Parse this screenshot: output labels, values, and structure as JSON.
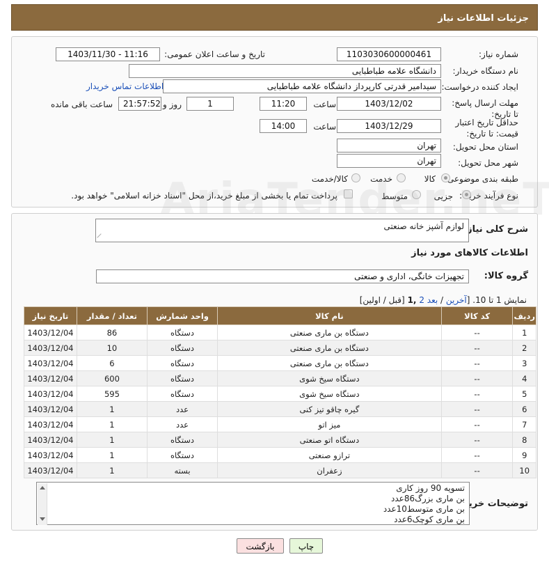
{
  "header": {
    "title": "جزئیات اطلاعات نیاز"
  },
  "fields": {
    "need_number_label": "شماره نیاز:",
    "need_number": "1103030600000461",
    "announce_label": "تاریخ و ساعت اعلان عمومی:",
    "announce_value": "1403/11/30 - 11:16",
    "buyer_org_label": "نام دستگاه خریدار:",
    "buyer_org": "دانشگاه علامه طباطبایی",
    "creator_label": "ایجاد کننده درخواست:",
    "creator": "سیدامیر قدرتی کارپرداز دانشگاه علامه طباطبایی",
    "buyer_contact_link": "اطلاعات تماس خریدار",
    "reply_deadline_label": "مهلت ارسال پاسخ: تا تاریخ:",
    "reply_date": "1403/12/02",
    "time_label": "ساعت",
    "reply_time": "11:20",
    "days_value": "1",
    "days_label": "روز و",
    "remaining_time": "21:57:52",
    "remaining_label": "ساعت باقی مانده",
    "validity_label": "حداقل تاریخ اعتبار قیمت: تا تاریخ:",
    "validity_date": "1403/12/29",
    "validity_time": "14:00",
    "province_label": "استان محل تحویل:",
    "province": "تهران",
    "city_label": "شهر محل تحویل:",
    "city": "تهران",
    "category_label": "طبقه بندی موضوعی:",
    "category_options": [
      "کالا",
      "خدمت",
      "کالا/خدمت"
    ],
    "process_label": "نوع فرآیند خرید :",
    "process_options": [
      "جزیی",
      "متوسط"
    ],
    "payment_note": "پرداخت تمام یا بخشی از مبلغ خرید،از محل \"اسناد خزانه اسلامی\" خواهد بود."
  },
  "details": {
    "description_label": "شرح کلی نیاز:",
    "description": "لوازم آشپز خانه صنعتی",
    "goods_info_title": "اطلاعات کالاهای مورد نیاز",
    "goods_group_label": "گروه کالا:",
    "goods_group": "تجهیزات خانگی، اداری و صنعتی",
    "pagination_prefix": "نمایش 1 تا 10. [",
    "pagination_last": "آخرین",
    "pagination_sep": " / ",
    "pagination_next": "بعد",
    "pagination_page2": "2",
    "pagination_page1": "1",
    "pagination_suffix": "[قبل / اولین]",
    "table": {
      "headers": [
        "ردیف",
        "کد کالا",
        "نام کالا",
        "واحد شمارش",
        "تعداد / مقدار",
        "تاریخ نیاز"
      ],
      "rows": [
        [
          "1",
          "--",
          "دستگاه بن ماری صنعتی",
          "دستگاه",
          "86",
          "1403/12/04"
        ],
        [
          "2",
          "--",
          "دستگاه بن ماری صنعتی",
          "دستگاه",
          "10",
          "1403/12/04"
        ],
        [
          "3",
          "--",
          "دستگاه بن ماری صنعتی",
          "دستگاه",
          "6",
          "1403/12/04"
        ],
        [
          "4",
          "--",
          "دستگاه سیخ شوی",
          "دستگاه",
          "600",
          "1403/12/04"
        ],
        [
          "5",
          "--",
          "دستگاه سیخ شوی",
          "دستگاه",
          "595",
          "1403/12/04"
        ],
        [
          "6",
          "--",
          "گیره چاقو تیز کنی",
          "عدد",
          "1",
          "1403/12/04"
        ],
        [
          "7",
          "--",
          "میز اتو",
          "عدد",
          "1",
          "1403/12/04"
        ],
        [
          "8",
          "--",
          "دستگاه اتو صنعتی",
          "دستگاه",
          "1",
          "1403/12/04"
        ],
        [
          "9",
          "--",
          "ترازو صنعتی",
          "دستگاه",
          "1",
          "1403/12/04"
        ],
        [
          "10",
          "--",
          "زعفران",
          "بسته",
          "1",
          "1403/12/04"
        ]
      ]
    },
    "buyer_notes_label": "توضیحات خریدار:",
    "buyer_notes": [
      "تسویه 90 روز کاری",
      "بن ماری بزرگ86عدد",
      "بن ماری متوسط10عدد",
      "بن ماری کوچک6عدد"
    ]
  },
  "buttons": {
    "print": "چاپ",
    "back": "بازگشت"
  },
  "watermark": "AriaTender.neT",
  "colors": {
    "header_bg": "#8b6a3e",
    "link": "#1a4fb8",
    "print_btn": "#e6f7d9",
    "back_btn": "#fbe0e0"
  }
}
